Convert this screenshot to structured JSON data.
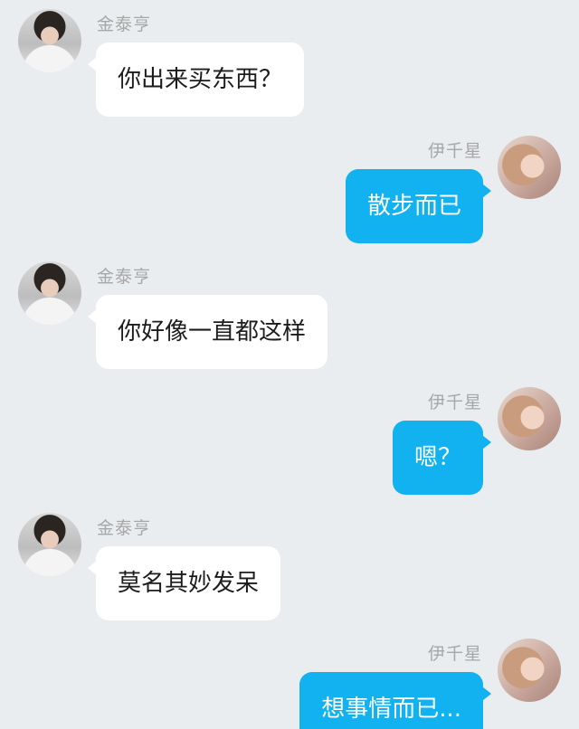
{
  "messages": [
    {
      "side": "left",
      "sender": "金泰亨",
      "text": "你出来买东西？"
    },
    {
      "side": "right",
      "sender": "伊千星",
      "text": "散步而已"
    },
    {
      "side": "left",
      "sender": "金泰亨",
      "text": "你好像一直都这样"
    },
    {
      "side": "right",
      "sender": "伊千星",
      "text": "嗯？"
    },
    {
      "side": "left",
      "sender": "金泰亨",
      "text": "莫名其妙发呆"
    },
    {
      "side": "right",
      "sender": "伊千星",
      "text": "想事情而已..."
    }
  ],
  "colors": {
    "background": "#e9edf0",
    "incoming_bubble": "#ffffff",
    "outgoing_bubble": "#12b1ef",
    "name_text": "#a7a7a7"
  }
}
